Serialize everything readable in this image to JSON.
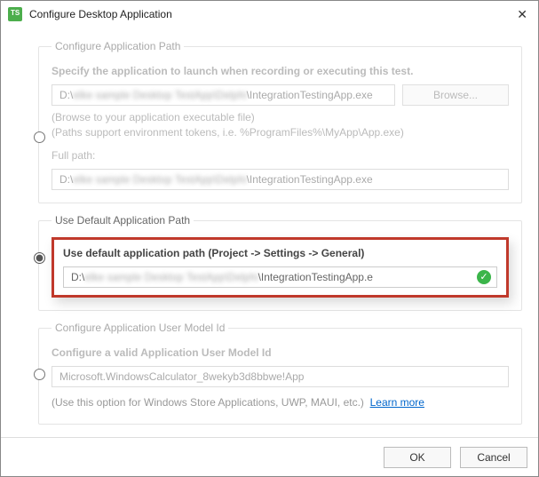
{
  "window": {
    "title": "Configure Desktop Application"
  },
  "section1": {
    "legend": "Configure Application Path",
    "desc": "Specify the application to launch when recording or executing this test.",
    "path_prefix": "D:\\",
    "path_blurred": "elke sample Desktop TestApp\\Delphi",
    "path_suffix": "\\IntegrationTestingApp.exe",
    "browse": "Browse...",
    "help1": "(Browse to your application executable file)",
    "help2": "(Paths support environment tokens, i.e. %ProgramFiles%\\MyApp\\App.exe)",
    "fullpath_label": "Full path:",
    "fullpath_prefix": "D:\\",
    "fullpath_blurred": "elke sample Desktop TestApp\\Delphi",
    "fullpath_suffix": "\\IntegrationTestingApp.exe"
  },
  "section2": {
    "legend": "Use Default Application Path",
    "title_line": "Use default application path (Project -> Settings -> General)",
    "path_prefix": "D:\\",
    "path_blurred": "elke sample Desktop TestApp\\Delphi",
    "path_suffix": "\\IntegrationTestingApp.e"
  },
  "section3": {
    "legend": "Configure Application User Model Id",
    "desc": "Configure a valid Application User Model Id",
    "placeholder": "Microsoft.WindowsCalculator_8wekyb3d8bbwe!App",
    "help": "(Use this option for Windows Store Applications, UWP, MAUI, etc.)",
    "learn": "Learn more"
  },
  "footer": {
    "ok": "OK",
    "cancel": "Cancel"
  }
}
